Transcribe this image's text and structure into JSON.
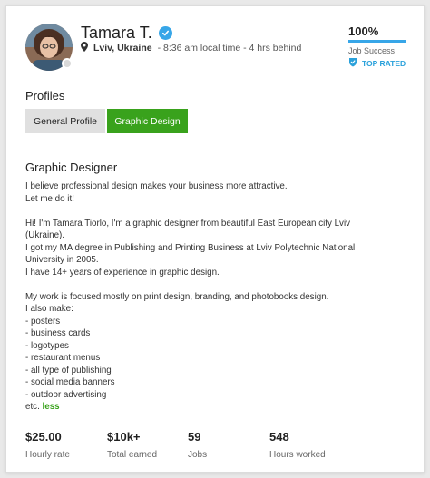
{
  "profile": {
    "name": "Tamara T.",
    "city": "Lviv, Ukraine",
    "time_info": "- 8:36 am local time - 4 hrs behind",
    "job_success_value": "100%",
    "job_success_fraction": 1.0,
    "job_success_label": "Job Success",
    "top_rated_label": "TOP RATED"
  },
  "profiles": {
    "title": "Profiles",
    "tabs": [
      {
        "label": "General Profile",
        "active": false
      },
      {
        "label": "Graphic Design",
        "active": true
      }
    ]
  },
  "section": {
    "title": "Graphic Designer",
    "lines": [
      "I believe professional design makes your business more attractive.",
      "Let me do it!",
      "",
      "Hi! I'm Tamara Tiorlo, I'm a graphic designer from beautiful East European city Lviv",
      "(Ukraine).",
      "I got my MA degree in Publishing and Printing Business at Lviv Polytechnic National",
      "University in 2005.",
      "I have 14+ years of experience in graphic design.",
      "",
      "My work is focused mostly on print design, branding, and photobooks design.",
      "I also make:",
      "- posters",
      "- business cards",
      "- logotypes",
      "- restaurant menus",
      "- all type of publishing",
      "- social media banners",
      "- outdoor advertising"
    ],
    "last_line_prefix": "etc.",
    "less_link": "less"
  },
  "stats": [
    {
      "value": "$25.00",
      "label": "Hourly rate"
    },
    {
      "value": "$10k+",
      "label": "Total earned"
    },
    {
      "value": "59",
      "label": "Jobs"
    },
    {
      "value": "548",
      "label": "Hours worked"
    }
  ],
  "colors": {
    "accent_green": "#39a21c",
    "verified_blue": "#37a6e8",
    "top_rated_blue": "#2aa1db"
  },
  "icons": {
    "verified": "verified-check-icon",
    "location": "map-pin-icon",
    "top_rated": "shield-badge-icon"
  }
}
